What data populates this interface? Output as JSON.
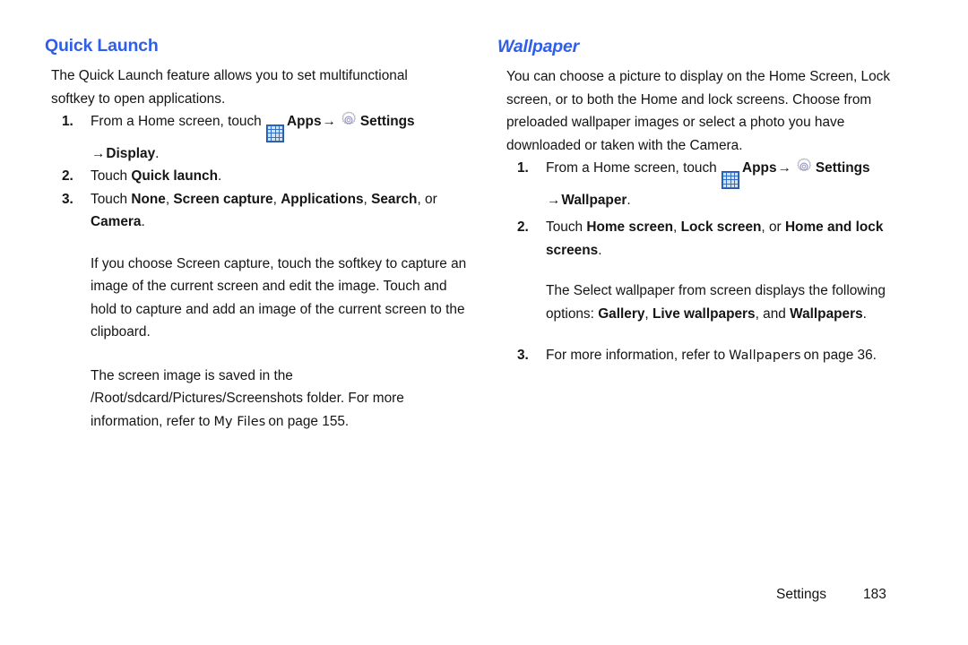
{
  "document": {
    "background": "#ffffff",
    "heading_color": "#2f5fe8",
    "apps_icon_color": "#2f6fd0",
    "gear_icon_color": "#b8b8b8",
    "gear_ring_color": "#8f8fe0"
  },
  "left_column": {
    "heading": "Quick Launch",
    "intro": "The Quick Launch feature allows you to set multifunctional softkey to open applications.",
    "steps": [
      {
        "number": "1.",
        "pre_text": "From a Home screen, touch ",
        "apps_label": "Apps",
        "arrow1": "→",
        "settings_label": "Settings",
        "arrow2": "→",
        "final_label": "Display",
        "final_period": "."
      },
      {
        "number": "2.",
        "text_before": "Touch ",
        "bold_1": "Quick launch",
        "text_after": "."
      },
      {
        "number": "3.",
        "text_before": "Touch ",
        "bold_1": "None",
        "sep_1": ", ",
        "bold_2": "Screen capture",
        "sep_2": ", ",
        "bold_3": "Applications",
        "sep_3": ", ",
        "bold_4": "Search",
        "sep_4": ", or ",
        "bold_5": "Camera",
        "text_after": "."
      }
    ],
    "paragraphs": [
      "If you choose Screen capture, touch the softkey to capture an image of the current screen and edit the image. Touch and hold to capture and add an image of the current screen to the clipboard.",
      {
        "before": "The screen image is saved in the /Root/sdcard/Pictures/Screenshots folder. For more information, refer to",
        "xref": "My Files",
        "after": "on page 155."
      }
    ]
  },
  "right_column": {
    "heading": "Wallpaper",
    "intro": "You can choose a picture to display on the Home Screen, Lock screen, or to both the Home and lock screens. Choose from preloaded wallpaper images or select a photo you have downloaded or taken with the Camera.",
    "steps": [
      {
        "number": "1.",
        "pre_text": "From a Home screen, touch ",
        "apps_label": "Apps",
        "arrow1": "→",
        "settings_label": "Settings",
        "arrow2": "→",
        "final_label": "Wallpaper",
        "final_period": "."
      },
      {
        "number": "2.",
        "text_before": "Touch ",
        "bold_1": "Home screen",
        "sep_1": ", ",
        "bold_2": "Lock screen",
        "sep_2": ", or ",
        "bold_3": "Home and lock screens",
        "text_after": "."
      },
      {
        "number": "3.",
        "before": "For more information, refer to",
        "xref": "Wallpapers",
        "after": "on page 36."
      }
    ],
    "note": {
      "before": "The Select wallpaper from screen displays the following options: ",
      "bold_1": "Gallery",
      "sep_1": ", ",
      "bold_2": "Live wallpapers",
      "sep_2": ", and ",
      "bold_3": "Wallpapers",
      "after": "."
    }
  },
  "footer": {
    "label": "Settings",
    "page_number": "183"
  }
}
